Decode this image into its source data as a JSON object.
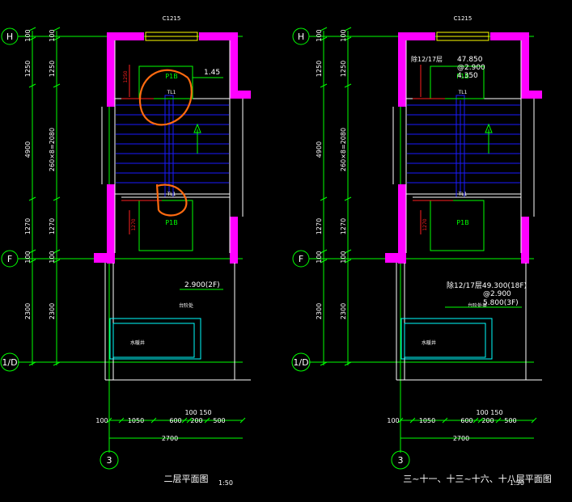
{
  "colors": {
    "background": "#000000",
    "grid": "#00ff00",
    "wall": "#ff00ff",
    "stair": "#1a1aff",
    "text": "#ffffff",
    "level": "#ffff00",
    "red": "#ff2020",
    "cyan": "#00ffff",
    "annotation": "#ff6a10"
  },
  "left": {
    "window_tag": "C1215",
    "axis_top": "H",
    "axis_mid": "F",
    "axis_bot": "1/D",
    "axis_col": "3",
    "outer_dims": [
      "100",
      "1250",
      "4900",
      "1270",
      "100",
      "2300"
    ],
    "inner_dims": [
      "100",
      "1250",
      "260×8=2080",
      "1270",
      "100",
      "2300"
    ],
    "landing_top": "P1B",
    "landing_bot": "P1B",
    "stair_dim": "1250",
    "stair_dim2": "1270",
    "up_label_top": "TL1",
    "up_label_bot": "TL1",
    "level_top": "1.45",
    "level_bot": "2.900(2F)",
    "shaft_label": "水暖井",
    "room_label": "台阶处",
    "bottom_dims": [
      "100",
      "1050",
      "600",
      "200",
      "500"
    ],
    "bottom_dims_upper": "100  150",
    "bottom_total": "2700",
    "title": "二层平面图",
    "scale": "1:50"
  },
  "right": {
    "window_tag": "C1215",
    "axis_top": "H",
    "axis_mid": "F",
    "axis_bot": "1/D",
    "axis_col": "3",
    "outer_dims": [
      "100",
      "1250",
      "4900",
      "1270",
      "100",
      "2300"
    ],
    "inner_dims": [
      "100",
      "1250",
      "260×8=2080",
      "1270",
      "100",
      "2300"
    ],
    "note_top_1": "除12/17层",
    "note_top_2": "47.850",
    "note_top_3": "@2.900",
    "note_top_4": "4.350",
    "landing_top": "P1B",
    "landing_bot": "P1B",
    "stair_dim2": "1270",
    "up_label_top": "TL1",
    "up_label_bot": "TL1",
    "note_mid_1": "除12/17层49.300(18F)",
    "note_mid_2": "@2.900",
    "note_mid_3": "5.800(3F)",
    "shaft_label": "水暖井",
    "room_label": "台阶处盖",
    "bottom_dims": [
      "100",
      "1050",
      "600",
      "200",
      "500"
    ],
    "bottom_dims_upper": "100  150",
    "bottom_total": "2700",
    "title": "三~十一、十三~十六、十八层平面图",
    "scale": "1:50"
  }
}
